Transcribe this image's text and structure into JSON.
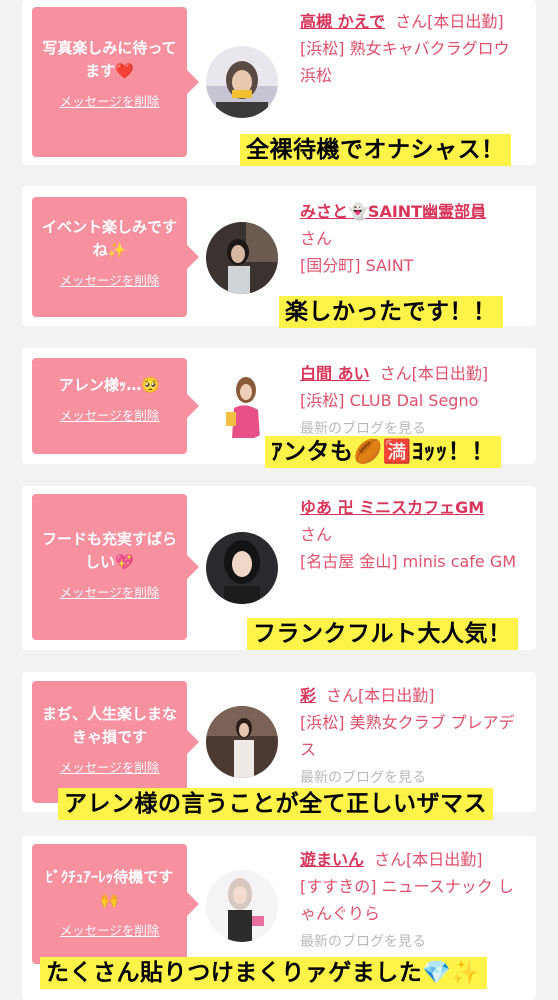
{
  "cards": [
    {
      "message": "写真楽しみに待ってます❤️",
      "delete_label": "メッセージを削除",
      "name": "高槻 かえで",
      "san": "さん",
      "status": "[本日出勤]",
      "shop": "[浜松] 熟女キャバクラグロウ 浜松",
      "blog": "",
      "caption": "全裸待機でオナシャス！"
    },
    {
      "message": "イベント楽しみですね✨",
      "delete_label": "メッセージを削除",
      "name": "みさと👻SAINT幽霊部員",
      "san": "さん",
      "status": "",
      "shop": "[国分町] SAINT",
      "blog": "",
      "caption": "楽しかったです！！"
    },
    {
      "message": "アレン様ｯ…🥺",
      "delete_label": "メッセージを削除",
      "name": "白間 あい",
      "san": "さん",
      "status": "[本日出勤]",
      "shop": "[浜松] CLUB Dal Segno",
      "blog": "最新のブログを見る",
      "caption": "ｱンタも🏉🈵ﾖｯｯ！！"
    },
    {
      "message": "フードも充実すばらしい💖",
      "delete_label": "メッセージを削除",
      "name": "ゆあ 卍 ミニスカフェGM",
      "san": "さん",
      "status": "",
      "shop": "[名古屋 金山] minis cafe GM",
      "blog": "",
      "caption": "フランクフルト大人気！"
    },
    {
      "message": "まぢ、人生楽しまなきゃ損です",
      "delete_label": "メッセージを削除",
      "name": "彩",
      "san": "さん",
      "status": "[本日出勤]",
      "shop": "[浜松] 美熟女クラブ プレアデス",
      "blog": "最新のブログを見る",
      "caption": "アレン様の言うことが全て正しいザマス"
    },
    {
      "message": "ﾋﾞｸﾁｭｱｰﾚｯ待機です🙌",
      "delete_label": "メッセージを削除",
      "name": "遊まいん",
      "san": "さん",
      "status": "[本日出勤]",
      "shop": "[すすきの] ニュースナック しゃんぐりら",
      "blog": "最新のブログを見る",
      "caption": "たくさん貼りつけまくりァゲました💎✨"
    }
  ],
  "colors": {
    "bubble": "#f7909f",
    "name": "#d9345a",
    "caption_bg": "#fff34a"
  }
}
